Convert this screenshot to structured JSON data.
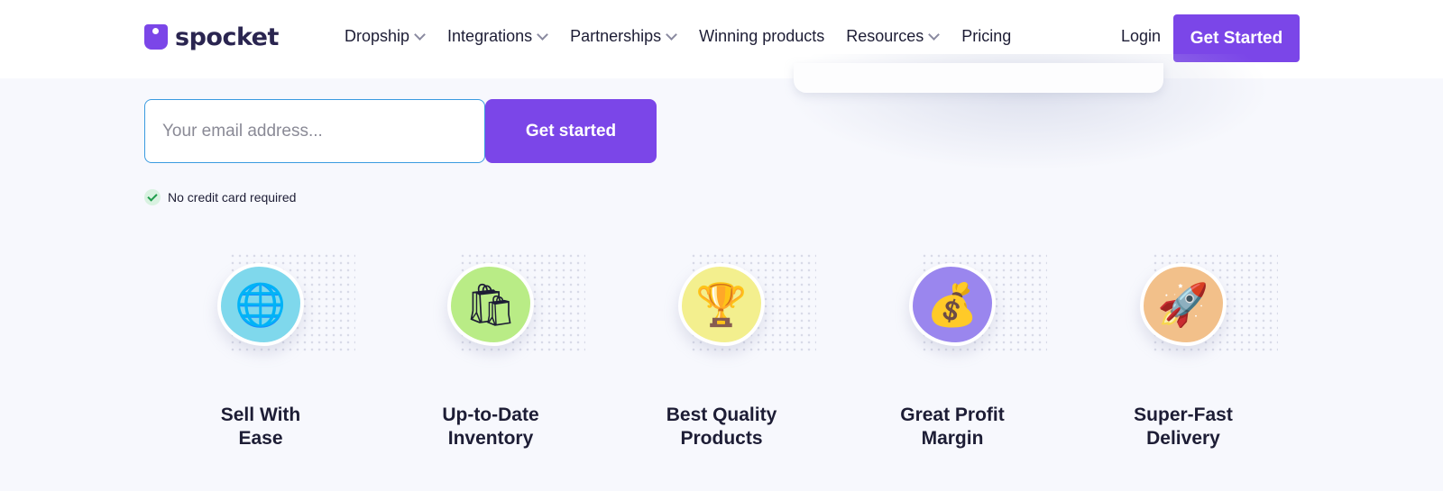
{
  "brand": {
    "name": "spocket",
    "accent": "#7b46e8"
  },
  "nav": [
    {
      "label": "Dropship",
      "dropdown": true
    },
    {
      "label": "Integrations",
      "dropdown": true
    },
    {
      "label": "Partnerships",
      "dropdown": true
    },
    {
      "label": "Winning products",
      "dropdown": false
    },
    {
      "label": "Resources",
      "dropdown": true
    },
    {
      "label": "Pricing",
      "dropdown": false
    }
  ],
  "header": {
    "login_label": "Login",
    "cta_label": "Get Started"
  },
  "form": {
    "email_placeholder": "Your email address...",
    "email_value": "",
    "submit_label": "Get started",
    "note": "No credit card required"
  },
  "features": [
    {
      "line1": "Sell With",
      "line2": "Ease",
      "icon": "globe-icon",
      "glyph": "🌐",
      "color": "#7fd8ec"
    },
    {
      "line1": "Up-to-Date",
      "line2": "Inventory",
      "icon": "shopping-bags-icon",
      "glyph": "🛍",
      "color": "#b9ec86"
    },
    {
      "line1": "Best Quality",
      "line2": "Products",
      "icon": "trophy-icon",
      "glyph": "🏆",
      "color": "#f3ef8e"
    },
    {
      "line1": "Great Profit",
      "line2": "Margin",
      "icon": "money-bag-icon",
      "glyph": "💰",
      "color": "#9a86ee"
    },
    {
      "line1": "Super-Fast",
      "line2": "Delivery",
      "icon": "rocket-icon",
      "glyph": "🚀",
      "color": "#f2c08a"
    }
  ]
}
